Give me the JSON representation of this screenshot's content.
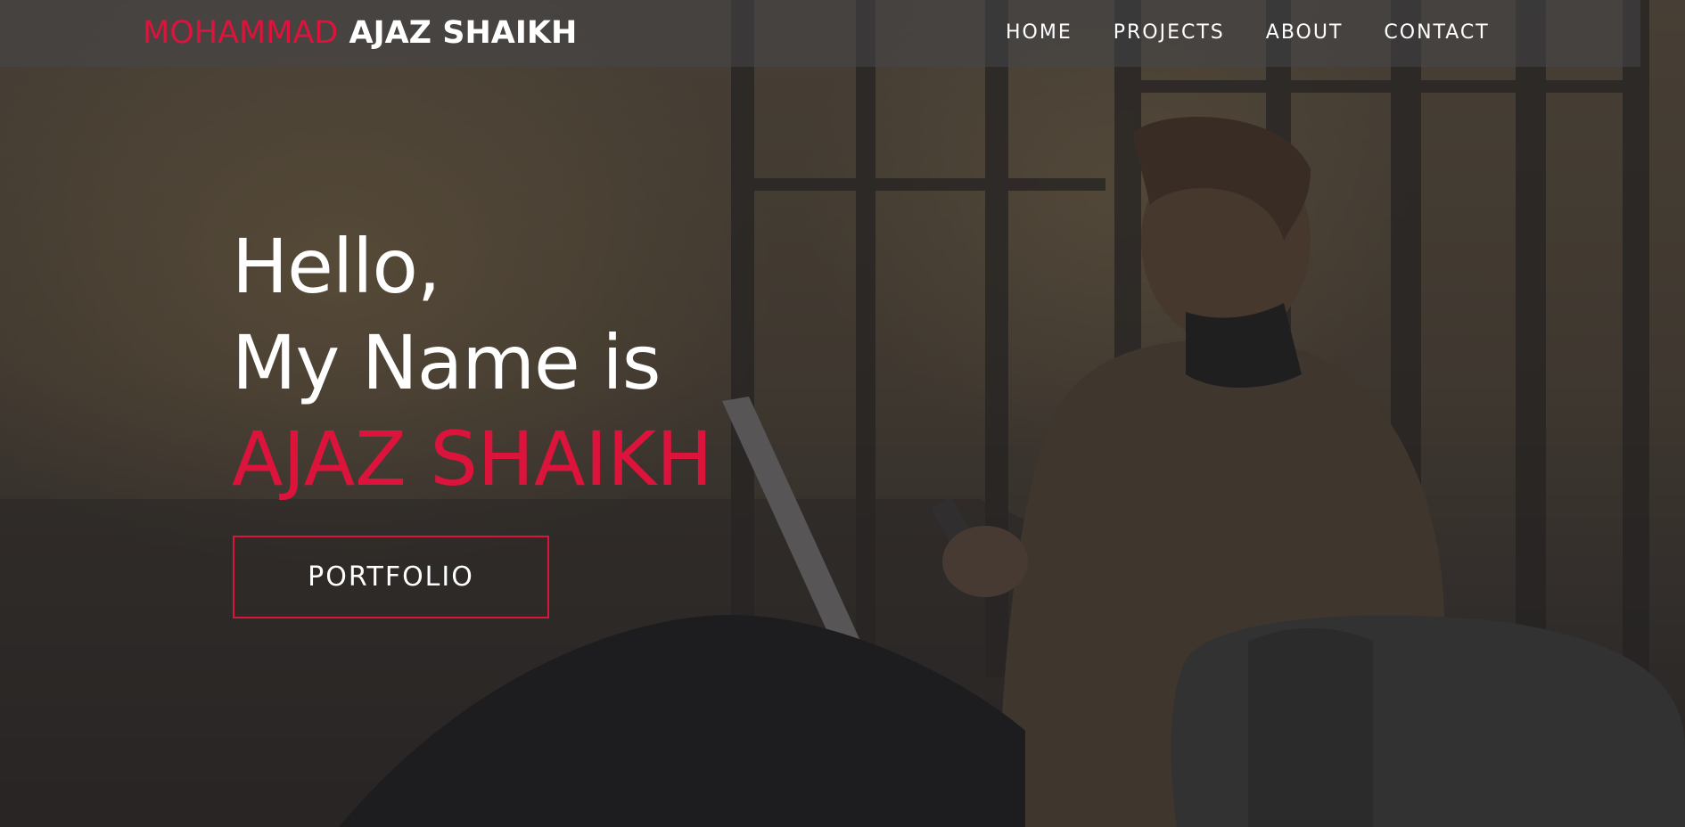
{
  "navbar": {
    "brand_first": "MOHAMMAD",
    "brand_last": "AJAZ SHAIKH",
    "links": [
      {
        "label": "HOME"
      },
      {
        "label": "PROJECTS"
      },
      {
        "label": "ABOUT"
      },
      {
        "label": "CONTACT"
      }
    ]
  },
  "hero": {
    "line1": "Hello,",
    "line2": "My Name is",
    "name": "AJAZ SHAIKH",
    "button_label": "PORTFOLIO"
  },
  "colors": {
    "accent": "#dc143c",
    "text": "#ffffff",
    "overlay": "#2a2a2e"
  }
}
